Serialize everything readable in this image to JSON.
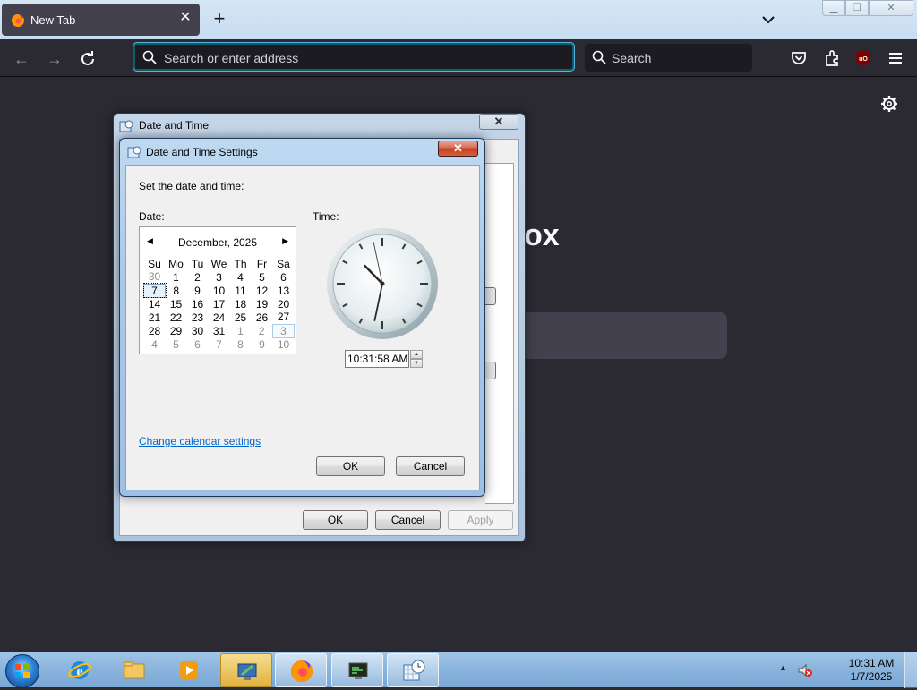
{
  "browser": {
    "tab_title": "New Tab",
    "url_placeholder": "Search or enter address",
    "search_placeholder": "Search",
    "brand_fragment": "ox",
    "accent": "#56b5e0"
  },
  "date_time_dialog": {
    "title": "Date and Time",
    "buttons": {
      "ok": "OK",
      "cancel": "Cancel",
      "apply": "Apply"
    }
  },
  "settings_dialog": {
    "title": "Date and Time Settings",
    "instruction": "Set the date and time:",
    "date_label": "Date:",
    "time_label": "Time:",
    "calendar": {
      "month_year": "December, 2025",
      "weekdays": [
        "Su",
        "Mo",
        "Tu",
        "We",
        "Th",
        "Fr",
        "Sa"
      ],
      "weeks": [
        [
          "30",
          "1",
          "2",
          "3",
          "4",
          "5",
          "6"
        ],
        [
          "7",
          "8",
          "9",
          "10",
          "11",
          "12",
          "13"
        ],
        [
          "14",
          "15",
          "16",
          "17",
          "18",
          "19",
          "20"
        ],
        [
          "21",
          "22",
          "23",
          "24",
          "25",
          "26",
          "27"
        ],
        [
          "28",
          "29",
          "30",
          "31",
          "1",
          "2",
          "3"
        ],
        [
          "4",
          "5",
          "6",
          "7",
          "8",
          "9",
          "10"
        ]
      ],
      "selected_day": "7"
    },
    "time_value": "10:31:58 AM",
    "clock": {
      "hour": 10,
      "minute": 31,
      "second": 58
    },
    "calendar_link": "Change calendar settings",
    "buttons": {
      "ok": "OK",
      "cancel": "Cancel"
    }
  },
  "taskbar": {
    "clock_time": "10:31 AM",
    "clock_date": "1/7/2025"
  }
}
